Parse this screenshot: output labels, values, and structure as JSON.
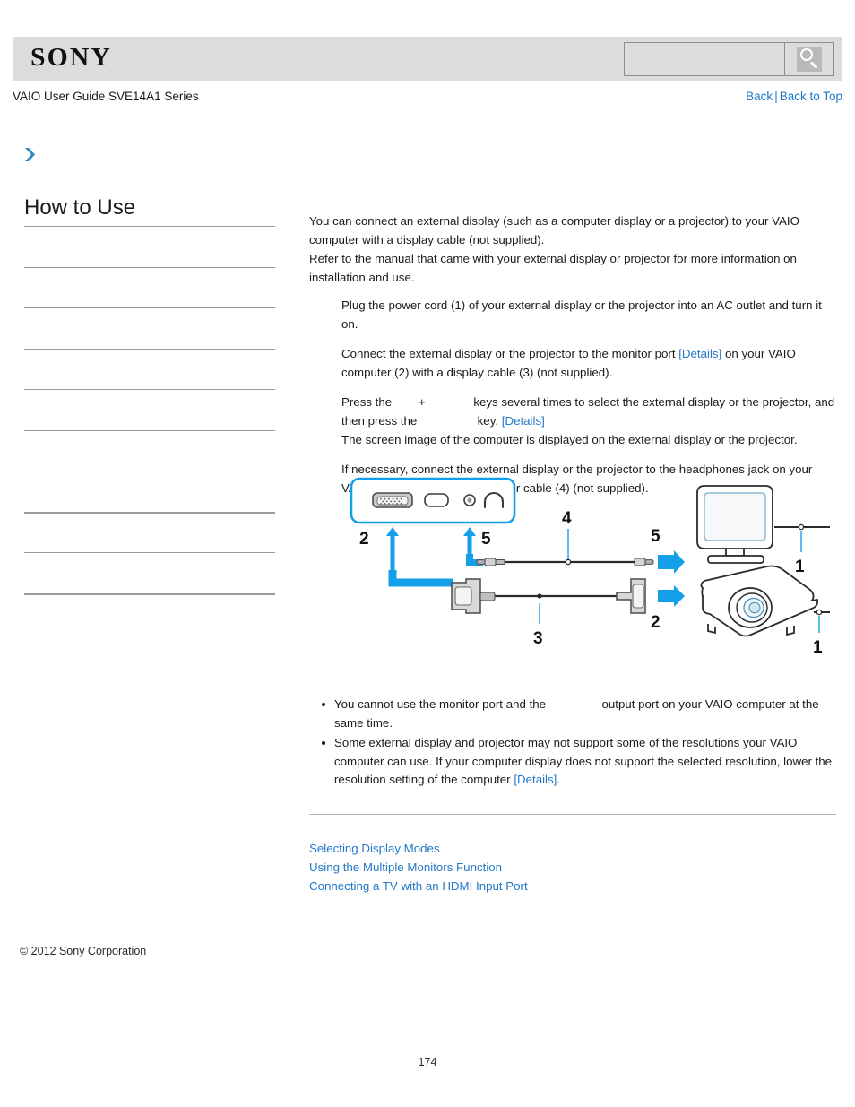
{
  "header": {
    "logo": "SONY",
    "search": {
      "value": "",
      "placeholder": "",
      "icon": "magnifier-icon",
      "button_label": ""
    }
  },
  "subheader": {
    "guide_title": "VAIO User Guide SVE14A1 Series",
    "back_label": "Back",
    "separator": "|",
    "back_to_top_label": "Back to Top"
  },
  "breadcrumb": {
    "icon": "chevron-right-icon"
  },
  "sidebar": {
    "title": "How to Use",
    "items": [
      {
        "label": ""
      },
      {
        "label": ""
      },
      {
        "label": ""
      },
      {
        "label": ""
      },
      {
        "label": ""
      },
      {
        "label": ""
      },
      {
        "label": ""
      },
      {
        "label": ""
      },
      {
        "label": ""
      }
    ]
  },
  "main": {
    "intro": [
      "You can connect an external display (such as a computer display or a projector) to your VAIO computer with a display cable (not supplied).",
      "Refer to the manual that came with your external display or projector for more information on installation and use."
    ],
    "steps": [
      {
        "text_1": "Plug the power cord (1) of your external display or the projector into an AC outlet and turn it on.",
        "link": "",
        "text_2": ""
      },
      {
        "text_1": "Connect the external display or the projector to the monitor port ",
        "link": "[Details]",
        "text_2": " on your VAIO computer (2) with a display cable (3) (not supplied)."
      },
      {
        "text_1": "Press the ",
        "text_plus": "+",
        "text_2": " keys several times to select the external display or the projector, and then press the ",
        "text_3": " key. ",
        "link": "[Details]",
        "text_4": "The screen image of the computer is displayed on the external display or the projector."
      },
      {
        "text_1": "If necessary, connect the external display or the projector to the headphones jack on your VAIO computer (5) with a speaker cable (4) (not supplied).",
        "link": "",
        "text_2": ""
      }
    ]
  },
  "diagram": {
    "name": "external-display-connection-diagram",
    "accent_color": "#13a0e8",
    "callouts": [
      {
        "number": "2",
        "meaning": "monitor port on VAIO"
      },
      {
        "number": "5",
        "meaning": "headphones jack on VAIO"
      },
      {
        "number": "4",
        "meaning": "speaker cable"
      },
      {
        "number": "3",
        "meaning": "display cable"
      },
      {
        "number": "1",
        "meaning": "power cord of display"
      },
      {
        "number": "1",
        "meaning": "power cord of projector"
      },
      {
        "number": "5",
        "meaning": "audio input on display"
      },
      {
        "number": "2",
        "meaning": "video input on projector"
      }
    ],
    "ports": [
      "vga-port-icon",
      "hdmi-port-icon",
      "headphone-jack-icon",
      "headphone-icon"
    ],
    "devices": [
      "crt-monitor-icon",
      "projector-icon"
    ]
  },
  "notes": {
    "items": [
      {
        "text_1": "You cannot use the monitor port and the ",
        "text_2": " output port on your VAIO computer at the same time.",
        "link": "",
        "text_3": ""
      },
      {
        "text_1": "Some external display and projector may not support some of the resolutions your VAIO computer can use. If your computer display does not support the selected resolution, lower the resolution setting of the computer ",
        "link": "[Details]",
        "text_2": ".",
        "text_3": ""
      }
    ]
  },
  "related": {
    "links": [
      "Selecting Display Modes",
      "Using the Multiple Monitors Function",
      "Connecting a TV with an HDMI Input Port"
    ]
  },
  "footer": {
    "copyright": "© 2012 Sony Corporation",
    "page_number": "174"
  }
}
